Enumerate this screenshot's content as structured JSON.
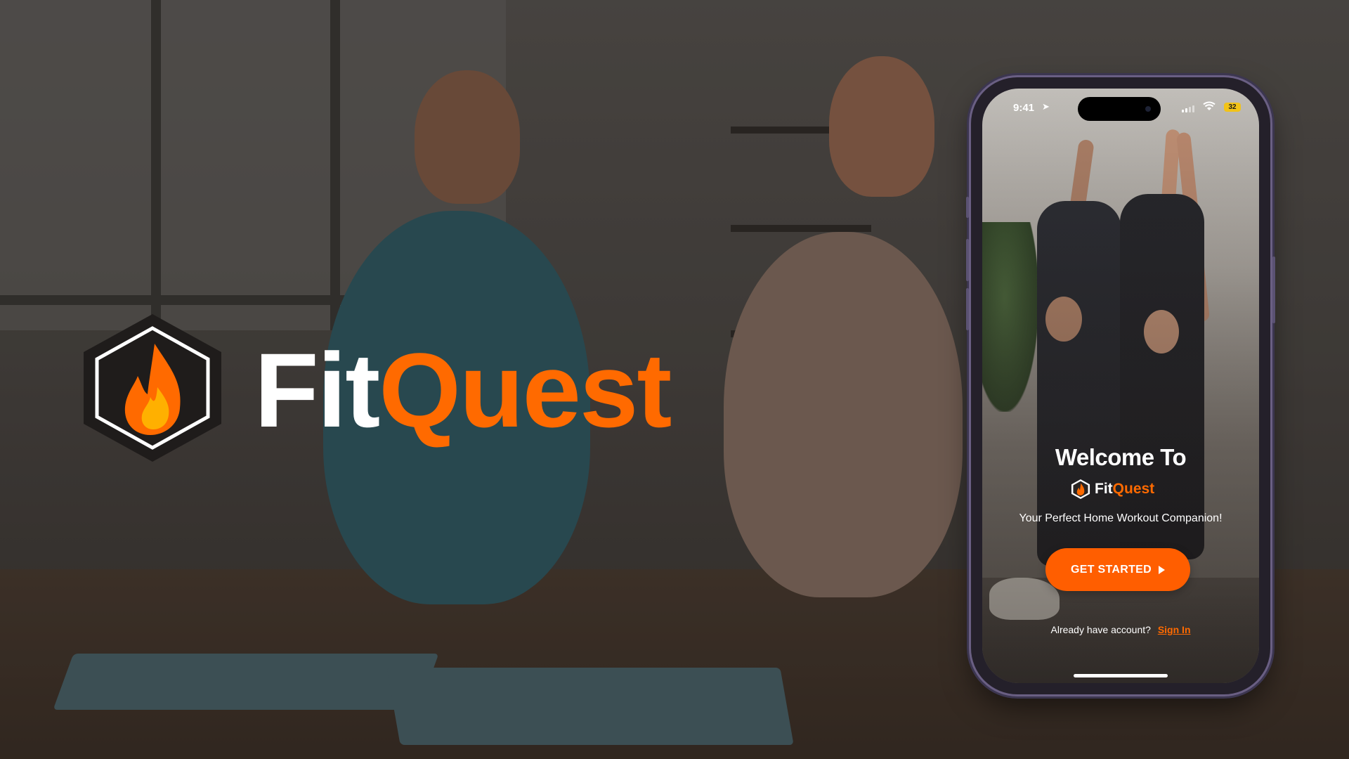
{
  "brand": {
    "part1": "Fit",
    "part2": "Quest",
    "accent_color": "#ff6a00",
    "logo_icon": "flame-hexagon-icon"
  },
  "phone": {
    "status": {
      "time": "9:41",
      "battery_level": "32",
      "icons": [
        "location-arrow-icon",
        "signal-icon",
        "wifi-icon",
        "battery-icon"
      ]
    },
    "welcome_title": "Welcome To",
    "tagline": "Your Perfect Home Workout Companion!",
    "cta_label": "GET STARTED",
    "account_prompt": "Already have account?",
    "signin_label": "Sign In"
  }
}
